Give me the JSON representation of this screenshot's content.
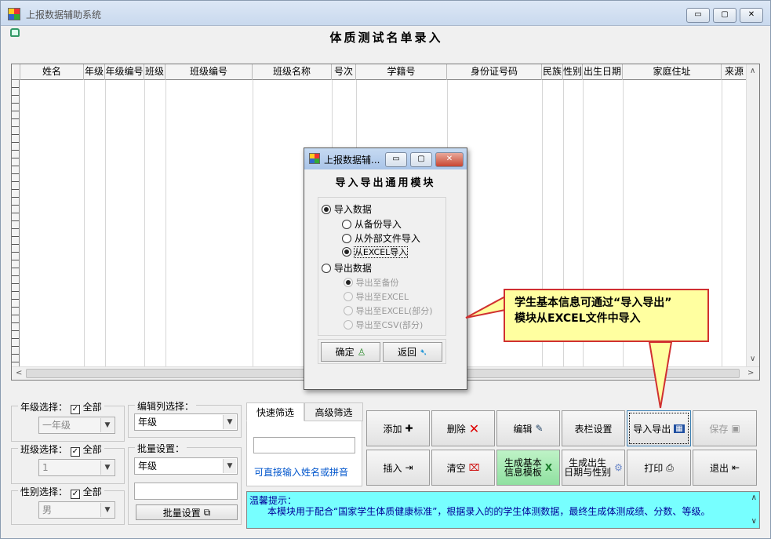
{
  "window": {
    "title": "上报数据辅助系统",
    "min": "▭",
    "max": "▢",
    "close": "✕"
  },
  "page_title": "体质测试名单录入",
  "grid": {
    "columns": [
      "姓名",
      "年级",
      "年级编号",
      "班级",
      "班级编号",
      "班级名称",
      "号次",
      "学籍号",
      "身份证号码",
      "民族",
      "性别",
      "出生日期",
      "家庭住址",
      "来源"
    ]
  },
  "grade_filter": {
    "label": "年级选择：",
    "all_label": "全部",
    "value": "一年级"
  },
  "class_filter": {
    "label": "班级选择：",
    "all_label": "全部",
    "value": "1"
  },
  "gender_filter": {
    "label": "性别选择：",
    "all_label": "全部",
    "value": "男"
  },
  "edit_col": {
    "label": "编辑列选择：",
    "value": "年级"
  },
  "batch": {
    "label": "批量设置：",
    "value": "年级",
    "button": "批量设置"
  },
  "tabs": {
    "quick": "快速筛选",
    "advanced": "高级筛选",
    "hint": "可直接输入姓名或拼音"
  },
  "buttons": {
    "add": "添加",
    "delete": "删除",
    "edit": "编辑",
    "columns": "表栏设置",
    "import_export": "导入导出",
    "save": "保存",
    "insert": "插入",
    "clear": "清空",
    "gen_template_1": "生成基本",
    "gen_template_2": "信息模板",
    "gen_birth_1": "生成出生",
    "gen_birth_2": "日期与性别",
    "print": "打印",
    "exit": "退出"
  },
  "tip": {
    "title": "温馨提示：",
    "text": "本模块用于配合“国家学生体质健康标准”，根据录入的的学生体测数据，最终生成体测成绩、分数、等级。"
  },
  "dialog": {
    "title": "上报数据辅...",
    "heading": "导入导出通用模块",
    "import_label": "导入数据",
    "import_backup": "从备份导入",
    "import_file": "从外部文件导入",
    "import_excel": "从EXCEL导入",
    "export_label": "导出数据",
    "export_backup": "导出至备份",
    "export_excel": "导出至EXCEL",
    "export_excel_part": "导出至EXCEL(部分)",
    "export_csv_part": "导出至CSV(部分)",
    "ok": "确定",
    "back": "返回"
  },
  "callout": {
    "line1": "学生基本信息可通过“导入导出”",
    "line2": "模块从EXCEL文件中导入"
  },
  "colors": {
    "callout_border": "#d03030",
    "callout_bg": "#ffffa0",
    "tip_bg": "#77ffff",
    "green_button": "#a6eab3"
  }
}
